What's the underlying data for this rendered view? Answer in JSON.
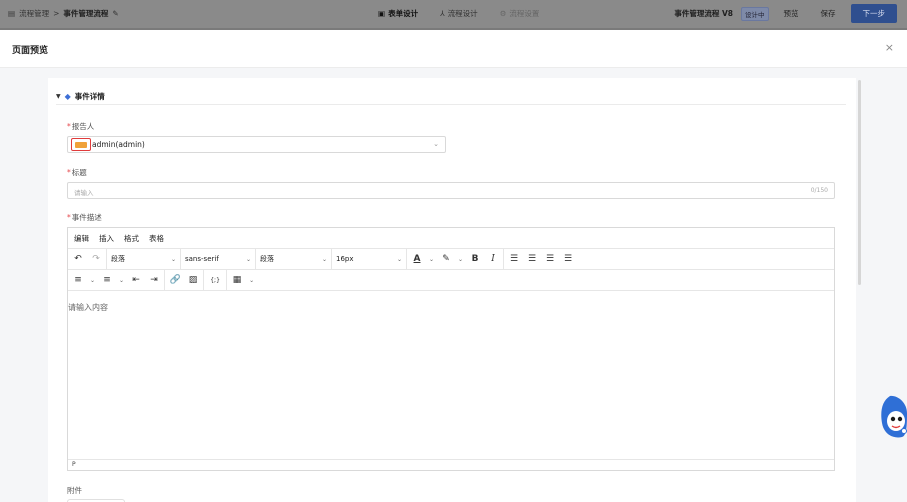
{
  "topbar": {
    "breadcrumb_root": "流程管理",
    "breadcrumb_sep": ">",
    "breadcrumb_current": "事件管理流程",
    "tabs": [
      {
        "label": "表单设计",
        "icon": "form-icon"
      },
      {
        "label": "流程设计",
        "icon": "flow-icon"
      },
      {
        "label": "流程设置",
        "icon": "settings-icon"
      }
    ],
    "flow_name": "事件管理流程 V8",
    "status_badge": "设计中",
    "preview_label": "预览",
    "save_label": "保存",
    "next_label": "下一步"
  },
  "modal": {
    "title": "页面预览",
    "close": "×"
  },
  "section": {
    "title": "事件详情"
  },
  "fields": {
    "reporter": {
      "label": "报告人",
      "required_mark": "*",
      "value": "admin(admin)"
    },
    "title": {
      "label": "标题",
      "required_mark": "*",
      "placeholder": "请输入",
      "count": "0/150"
    },
    "description": {
      "label": "事件描述",
      "required_mark": "*",
      "placeholder": "请输入内容"
    },
    "attachment": {
      "label": "附件"
    }
  },
  "editor": {
    "menus": [
      "编辑",
      "插入",
      "格式",
      "表格"
    ],
    "block_format": "段落",
    "font_family": "sans-serif",
    "line_format": "段落",
    "font_size": "16px",
    "code_label": "{;}",
    "status_path": "P"
  },
  "colors": {
    "required": "#e5484d",
    "primary": "#2f4f8f",
    "highlight_box": "#e03b3b"
  }
}
